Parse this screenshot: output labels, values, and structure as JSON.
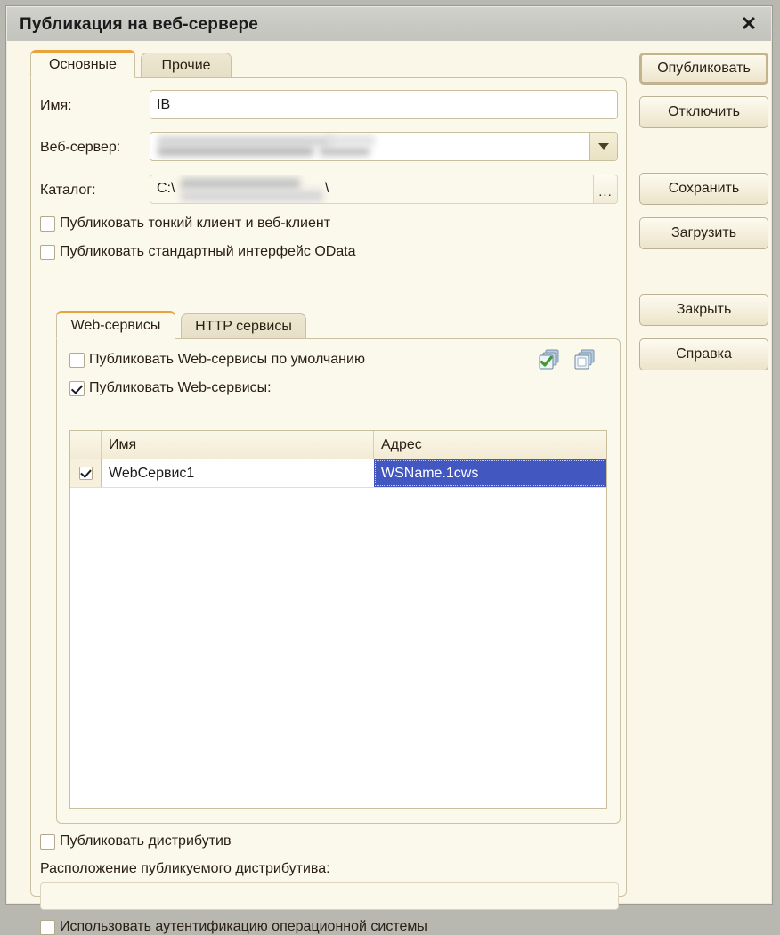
{
  "window": {
    "title": "Публикация на веб-сервере",
    "close_icon": "close-icon"
  },
  "outer_tabs": [
    {
      "label": "Основные",
      "active": true
    },
    {
      "label": "Прочие",
      "active": false
    }
  ],
  "form": {
    "name_label": "Имя:",
    "name_value": "IB",
    "webserver_label": "Веб-сервер:",
    "webserver_value": "",
    "webserver_redacted": true,
    "catalog_label": "Каталог:",
    "catalog_value_prefix": "C:\\",
    "catalog_value_suffix": "\\",
    "catalog_redacted": true,
    "ellipsis_button": "...",
    "checkbox_thin_client": "Публиковать тонкий клиент и веб-клиент",
    "checkbox_thin_client_checked": false,
    "checkbox_odata": "Публиковать стандартный интерфейс OData",
    "checkbox_odata_checked": false
  },
  "inner_tabs": [
    {
      "label": "Web-сервисы",
      "active": true
    },
    {
      "label": "HTTP сервисы",
      "active": false
    }
  ],
  "services": {
    "checkbox_default": "Публиковать Web-сервисы по умолчанию",
    "checkbox_default_checked": false,
    "checkbox_publish": "Публиковать Web-сервисы:",
    "checkbox_publish_checked": true,
    "toolbar": [
      {
        "icon": "check-all-icon"
      },
      {
        "icon": "uncheck-all-icon"
      }
    ],
    "columns": [
      "",
      "Имя",
      "Адрес"
    ],
    "rows": [
      {
        "checked": true,
        "name": "WebСервис1",
        "address": "WSName.1cws",
        "address_selected": true
      }
    ]
  },
  "distributive": {
    "checkbox_publish": "Публиковать дистрибутив",
    "checkbox_publish_checked": false,
    "location_label": "Расположение публикуемого дистрибутива:",
    "location_value": "",
    "checkbox_os_auth": "Использовать аутентификацию операционной системы",
    "checkbox_os_auth_checked": false
  },
  "buttons": [
    {
      "label": "Опубликовать",
      "focused": true
    },
    {
      "label": "Отключить",
      "focused": false
    },
    {
      "label": "Сохранить",
      "focused": false
    },
    {
      "label": "Загрузить",
      "focused": false
    },
    {
      "label": "Закрыть",
      "focused": false
    },
    {
      "label": "Справка",
      "focused": false
    }
  ],
  "colors": {
    "window_bg": "#fbf7e8",
    "titlebar": "#c9c9c4",
    "accent_tab": "#e8a33d",
    "selection": "#4257bf",
    "border": "#cbc2a4"
  }
}
